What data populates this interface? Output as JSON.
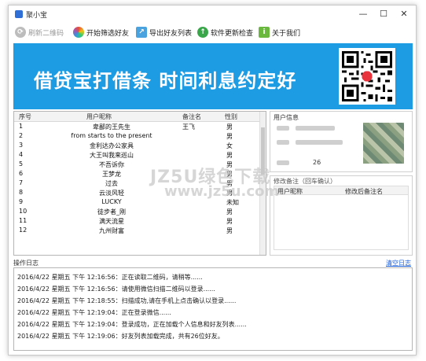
{
  "window": {
    "title": "聚小宝",
    "minimize": "—",
    "maximize": "☐",
    "close": "✕"
  },
  "toolbar": {
    "refresh_qr": "刷新二维码",
    "start_filter": "开始筛选好友",
    "export_list": "导出好友列表",
    "check_update": "软件更新检查",
    "about": "关于我们"
  },
  "banner": {
    "text": "借贷宝打借条  时间利息约定好"
  },
  "friends": {
    "columns": [
      "序号",
      "用户昵称",
      "备注名",
      "性别"
    ],
    "rows": [
      {
        "no": "1",
        "nick": "卑鄙的王先生",
        "remark": "王飞",
        "gender": "男"
      },
      {
        "no": "2",
        "nick": "from starts to the present",
        "remark": "",
        "gender": "男"
      },
      {
        "no": "3",
        "nick": "金利达办公家具",
        "remark": "",
        "gender": "女"
      },
      {
        "no": "4",
        "nick": "大王叫我来巡山",
        "remark": "",
        "gender": "男"
      },
      {
        "no": "5",
        "nick": "不吾诉你",
        "remark": "",
        "gender": "男"
      },
      {
        "no": "6",
        "nick": "王梦龙",
        "remark": "",
        "gender": "男"
      },
      {
        "no": "7",
        "nick": "过去",
        "remark": "",
        "gender": "男"
      },
      {
        "no": "8",
        "nick": "云淡风轻",
        "remark": "",
        "gender": "男"
      },
      {
        "no": "9",
        "nick": "LUCKY",
        "remark": "",
        "gender": "未知"
      },
      {
        "no": "10",
        "nick": "徒步者_刚",
        "remark": "",
        "gender": "男"
      },
      {
        "no": "11",
        "nick": "满天流星",
        "remark": "",
        "gender": "男"
      },
      {
        "no": "12",
        "nick": "九州财富",
        "remark": "",
        "gender": "男"
      }
    ]
  },
  "user_info": {
    "title": "用户信息",
    "age_value": "26"
  },
  "remark_panel": {
    "title": "修改备注（回车确认）",
    "columns": [
      "用户昵称",
      "修改后备注名"
    ]
  },
  "log": {
    "label": "操作日志",
    "clear": "清空日志",
    "lines": [
      "2016/4/22 星期五 下午 12:16:56：正在读取二维码，请稍等......",
      "2016/4/22 星期五 下午 12:16:56：请使用微信扫描二维码以登录......",
      "2016/4/22 星期五 下午 12:18:55：扫描成功,请在手机上点击确认以登录......",
      "2016/4/22 星期五 下午 12:19:04：正在登录微信......",
      "2016/4/22 星期五 下午 12:19:04：登录成功，正在加载个人信息和好友列表......",
      "2016/4/22 星期五 下午 12:19:06：好友列表加载完成，共有26位好友。"
    ]
  },
  "watermark": {
    "line1": "JZ5U绿色下载",
    "line2": "www.jz5u.com"
  },
  "colors": {
    "banner": "#1d9be3",
    "link": "#1d5fd6"
  }
}
